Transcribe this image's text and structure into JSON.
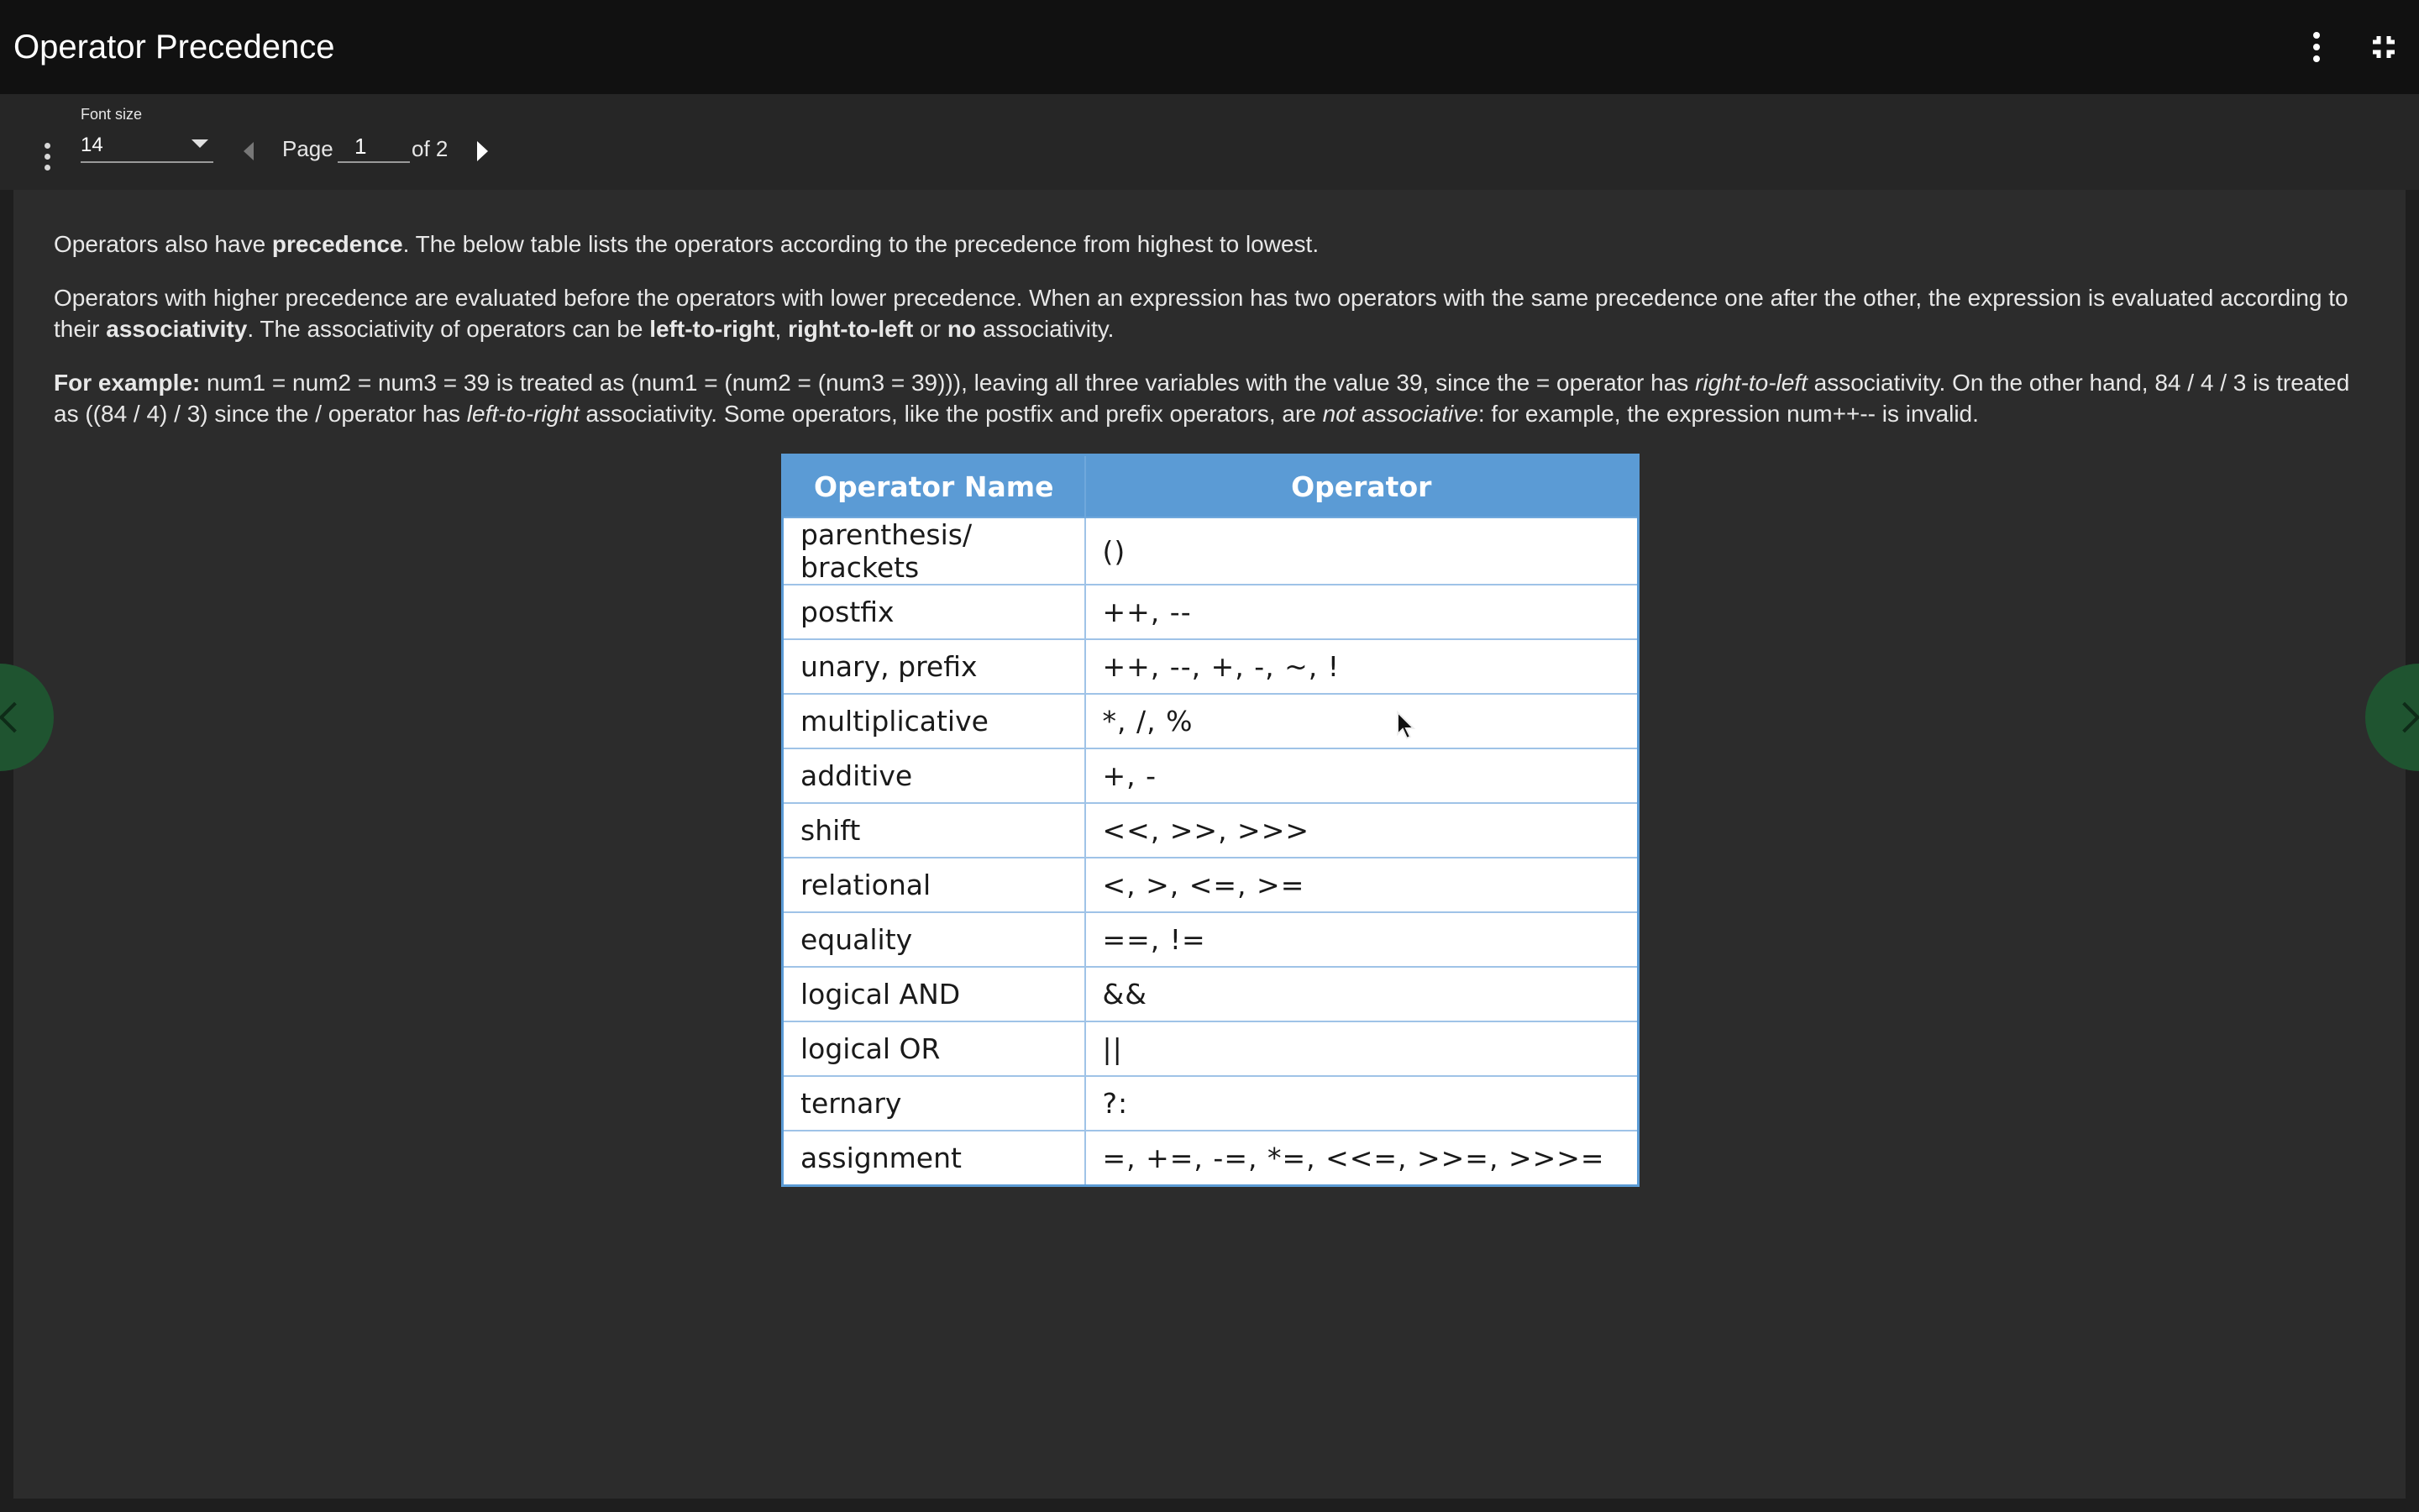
{
  "header": {
    "title": "Operator Precedence",
    "menu_icon": "more-vertical-icon",
    "exit_fullscreen_icon": "fullscreen-exit-icon"
  },
  "toolbar": {
    "font_size_label": "Font size",
    "font_size_value": "14",
    "page_label": "Page",
    "page_value": "1",
    "page_of": "of 2"
  },
  "content": {
    "p1": {
      "a": "Operators also have ",
      "b": "precedence",
      "c": ". The below table lists the operators according to the precedence from highest to lowest."
    },
    "p2": {
      "a": "Operators with higher precedence are evaluated before the operators with lower precedence. When an expression has two operators with the same precedence one after the other, the expression is evaluated according to their ",
      "b": "associativity",
      "c": ". The associativity of operators can be ",
      "d": "left-to-right",
      "e": ", ",
      "f": "right-to-left",
      "g": " or ",
      "h": "no",
      "i": " associativity."
    },
    "p3": {
      "a": "For example:",
      "b": " num1 = num2 = num3 = 39 is treated as (num1 = (num2 = (num3 = 39))), leaving all three variables with the value 39, since the = operator has ",
      "c": "right-to-left",
      "d": " associativity. On the other hand, 84 / 4 / 3 is treated as ((84 / 4) / 3) since the / operator has ",
      "e": "left-to-right",
      "f": " associativity. Some operators, like the postfix and prefix operators, are ",
      "g": "not associative",
      "h": ": for example, the expression num++-- is invalid."
    }
  },
  "table": {
    "headers": [
      "Operator Name",
      "Operator"
    ],
    "rows": [
      [
        "parenthesis/ brackets",
        "()"
      ],
      [
        "postfix",
        "++, --"
      ],
      [
        "unary, prefix",
        "++, --, +, -, ~, !"
      ],
      [
        "multiplicative",
        "*, /, %"
      ],
      [
        "additive",
        "+, -"
      ],
      [
        "shift",
        "<<, >>, >>>"
      ],
      [
        "relational",
        "<, >, <=, >="
      ],
      [
        "equality",
        "==, !="
      ],
      [
        "logical AND",
        "&&"
      ],
      [
        "logical OR",
        "||"
      ],
      [
        "ternary",
        "?:"
      ],
      [
        "assignment",
        "=, +=, -=, *=, <<=, >>=, >>>="
      ]
    ],
    "colors": {
      "header_bg": "#5b9bd5",
      "border": "#9fc3e7"
    }
  },
  "side_nav": {
    "prev_icon": "chevron-left-icon",
    "next_icon": "chevron-right-icon",
    "color": "#1f5430"
  }
}
